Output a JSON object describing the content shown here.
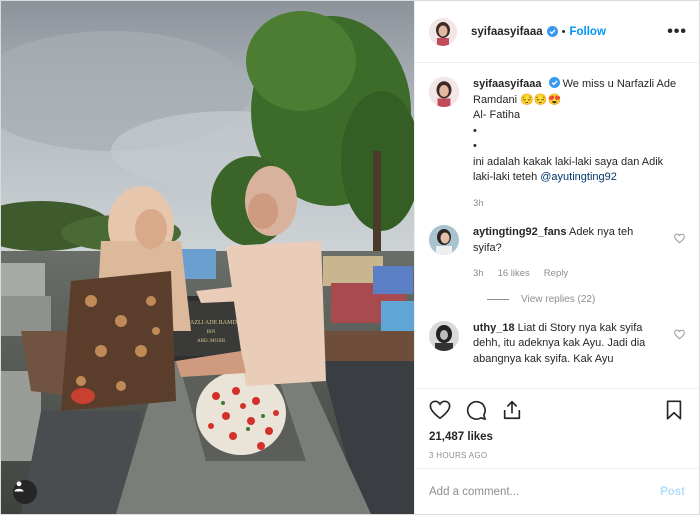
{
  "post": {
    "username": "syifaasyifaaa",
    "follow_label": "Follow",
    "more_label": "•••",
    "caption": {
      "username": "syifaasyifaaa",
      "line1": "We miss u Narfazli Ade Ramdani 😔😔😍",
      "line2": "Al- Fatiha",
      "bullet1": "•",
      "bullet2": "•",
      "line3": "ini adalah kakak laki-laki saya dan Adik laki-laki teteh",
      "mention": "@ayutingting92",
      "time": "3h"
    },
    "comments": [
      {
        "username": "aytingting92_fans",
        "text": "Adek nya teh syifa?",
        "time": "3h",
        "likes": "16 likes",
        "reply_label": "Reply",
        "view_replies": "View replies (22)"
      },
      {
        "username": "uthy_18",
        "text": "Liat di Story nya kak syifa dehh, itu adeknya kak Ayu. Jadi dia abangnya kak syifa. Kak Ayu dah ...(Liat di Story nya kak syifa)",
        "text_visible": "Liat di Story nya kak syifa dehh, itu adeknya kak Ayu. Jadi dia abangnya kak syifa. Kak Ayu"
      }
    ],
    "likes_count": "21,487 likes",
    "time_ago": "3 HOURS AGO",
    "comment_placeholder": "Add a comment...",
    "post_label": "Post",
    "tombstone_text": {
      "line1": "NARFAZLI ADE RAMDANI",
      "line2": "BIN",
      "line3": "ABD. MOJIB"
    }
  },
  "colors": {
    "link_blue": "#0095f6",
    "mention": "#00376b",
    "muted": "#8e8e8e",
    "border": "#efefef"
  },
  "icons": {
    "verified": "verified-badge-icon",
    "heart": "heart-icon",
    "comment": "comment-icon",
    "share": "share-icon",
    "save": "bookmark-icon",
    "user_tag": "user-tag-icon"
  }
}
